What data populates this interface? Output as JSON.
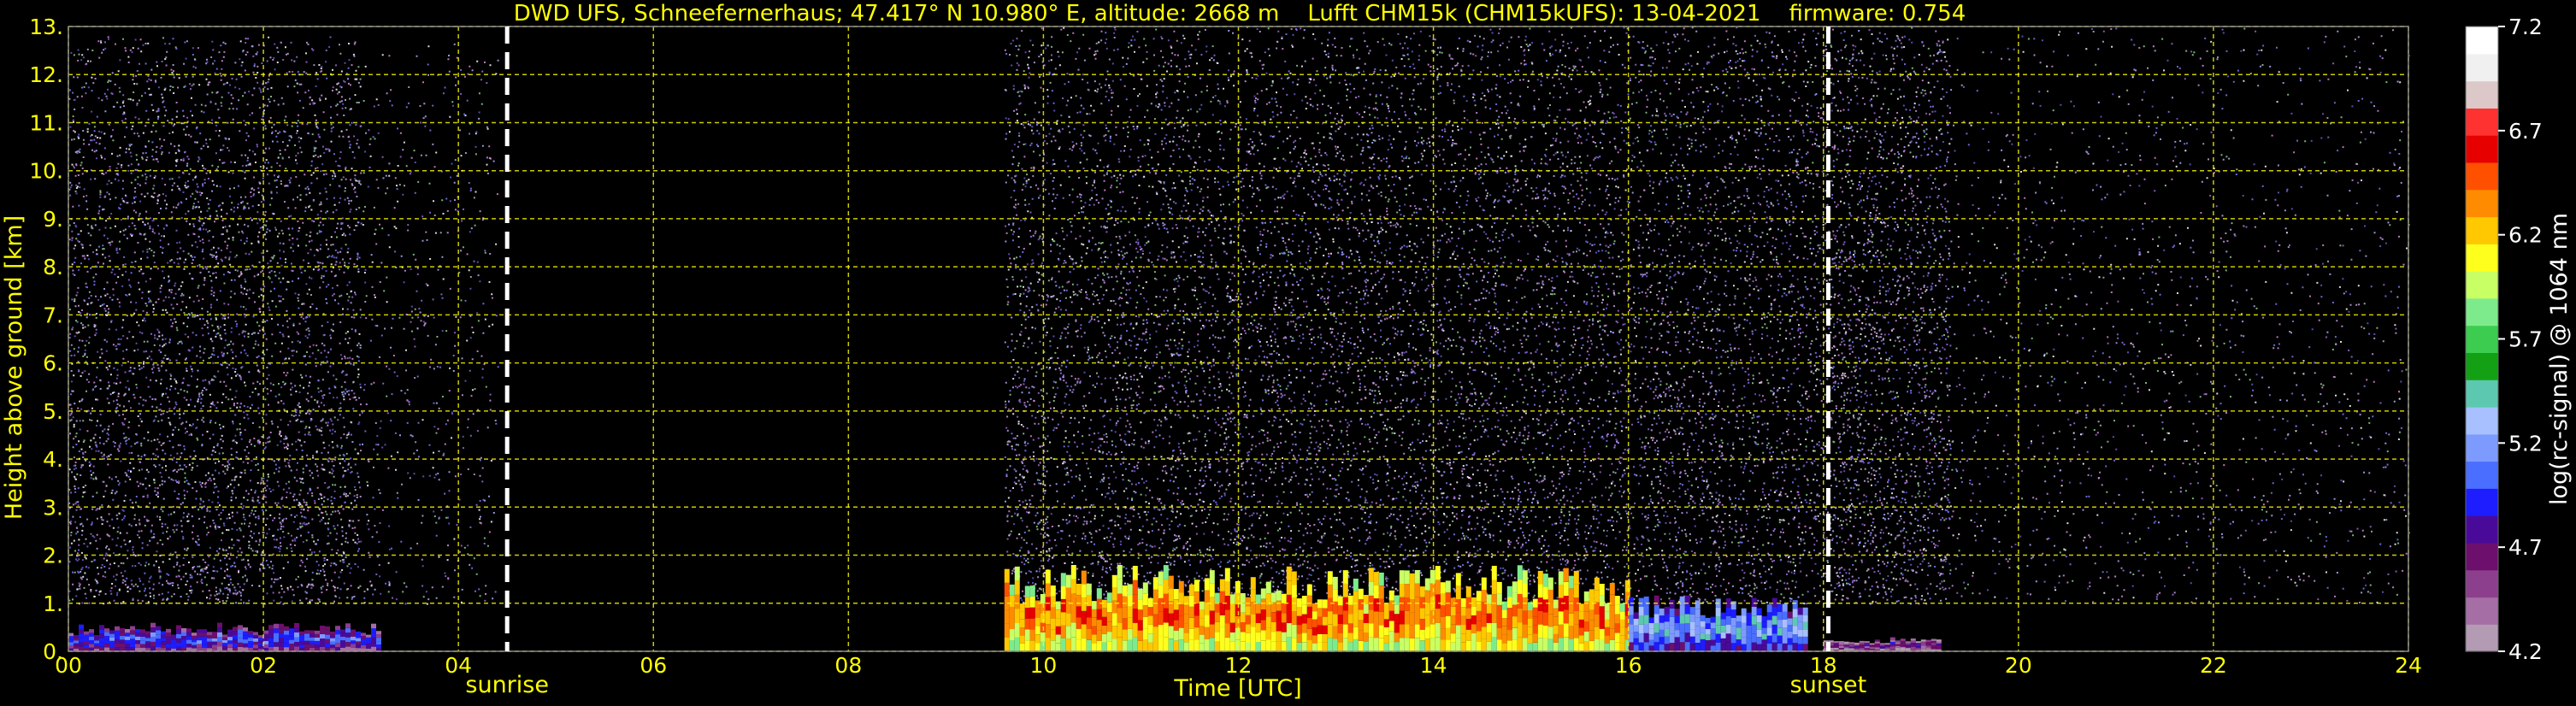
{
  "chart_data": {
    "type": "heatmap",
    "title": "DWD UFS, Schneefernerhaus; 47.417° N 10.980° E, altitude: 2668 m    Lufft CHM15k (CHM15kUFS): 13-04-2021    firmware: 0.754",
    "xlabel": "Time [UTC]",
    "ylabel": "Height above ground [km]",
    "xlim": [
      0,
      24
    ],
    "ylim": [
      0,
      13
    ],
    "x_ticks": [
      "00",
      "02",
      "04",
      "06",
      "08",
      "10",
      "12",
      "14",
      "16",
      "18",
      "20",
      "22",
      "24"
    ],
    "y_ticks": [
      "0.",
      "1.",
      "2.",
      "3.",
      "4.",
      "5.",
      "6.",
      "7.",
      "8.",
      "9.",
      "10.",
      "11.",
      "12.",
      "13."
    ],
    "grid": true,
    "grid_color": "#ffff00",
    "background": "#000000",
    "annotations": [
      {
        "label": "sunrise",
        "x": 4.5
      },
      {
        "label": "sunset",
        "x": 18.05
      }
    ],
    "colorbar": {
      "label": "log(rc-signal) @ 1064 nm",
      "range": [
        4.2,
        7.2
      ],
      "ticks": [
        "7.2",
        "6.7",
        "6.2",
        "5.7",
        "5.2",
        "4.7",
        "4.2"
      ],
      "colors": [
        "#b39bb3",
        "#a56ea5",
        "#8c3f8c",
        "#6d0f6d",
        "#4a0a99",
        "#1d1dff",
        "#4a6eff",
        "#7d9bff",
        "#a8c0ff",
        "#5dc8b0",
        "#14a014",
        "#3ccd50",
        "#7deb8c",
        "#c8ff64",
        "#ffff1e",
        "#ffc800",
        "#ff8c00",
        "#ff5000",
        "#e60000",
        "#ff3232",
        "#dcc8c8",
        "#f0f0f0",
        "#ffffff"
      ]
    },
    "noise_segments": [
      {
        "x_start": 0.0,
        "x_end": 3.0,
        "y_top": 12.8,
        "density": 0.55
      },
      {
        "x_start": 3.0,
        "x_end": 4.4,
        "y_top": 12.8,
        "density": 0.15
      },
      {
        "x_start": 9.6,
        "x_end": 18.0,
        "y_top": 13.0,
        "density": 1.0
      },
      {
        "x_start": 18.0,
        "x_end": 19.3,
        "y_top": 13.0,
        "density": 0.6
      },
      {
        "x_start": 19.3,
        "x_end": 24.0,
        "y_top": 13.0,
        "density": 0.12
      }
    ],
    "aerosol_layer": [
      {
        "x_start": 0.0,
        "x_end": 3.2,
        "y_top": 0.6,
        "level": 5.0
      },
      {
        "x_start": 9.6,
        "x_end": 16.0,
        "y_top": 1.8,
        "level": 6.5
      },
      {
        "x_start": 16.0,
        "x_end": 17.8,
        "y_top": 1.2,
        "level": 5.3
      },
      {
        "x_start": 18.0,
        "x_end": 19.2,
        "y_top": 0.3,
        "level": 4.7
      }
    ]
  }
}
